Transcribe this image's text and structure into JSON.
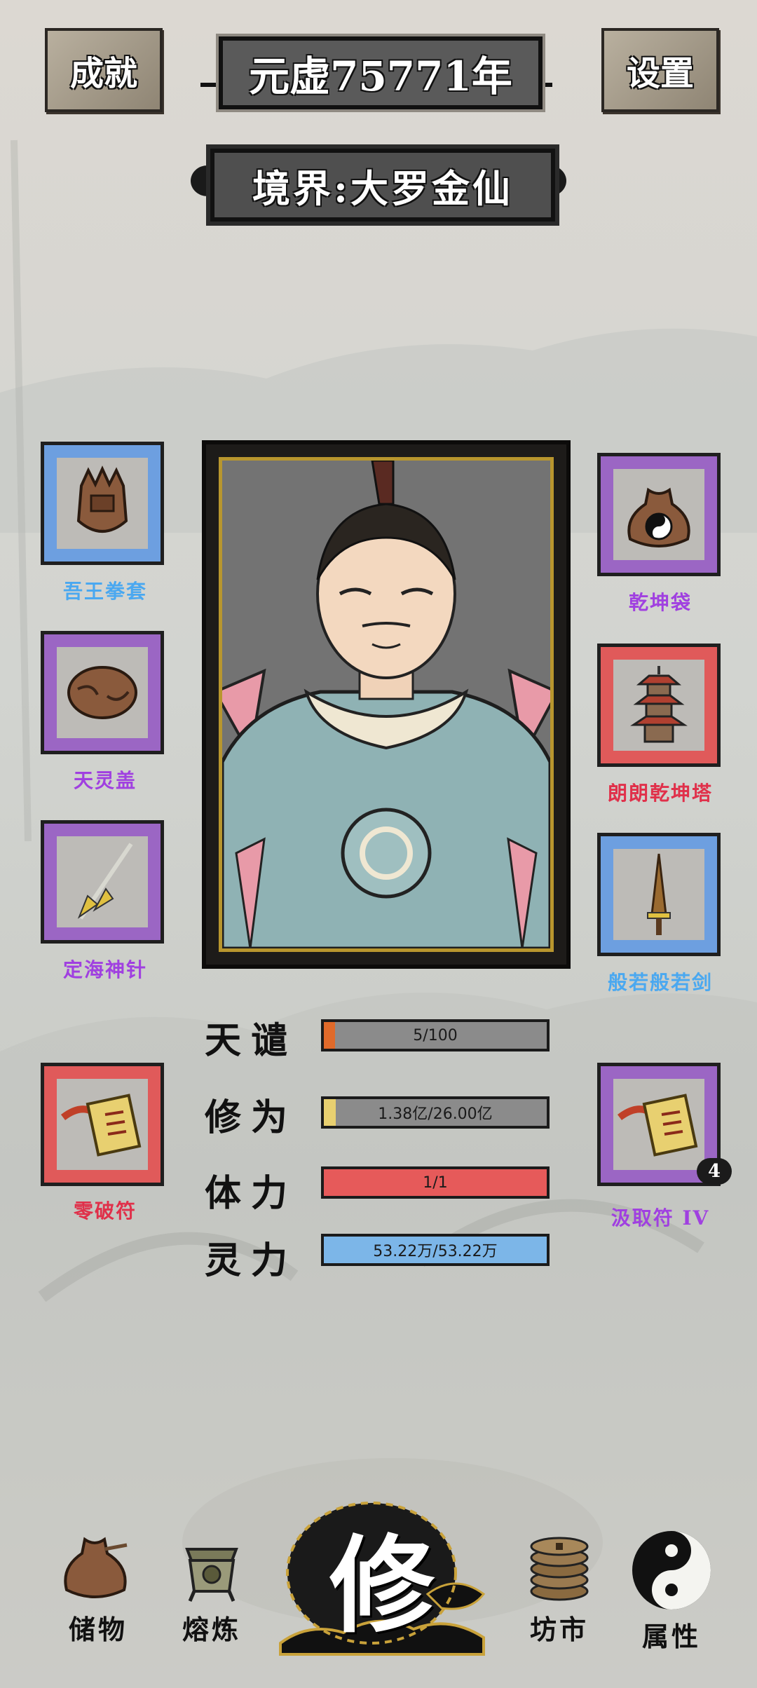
{
  "header": {
    "achievement_label": "成就",
    "settings_label": "设置",
    "year_label": "元虚75771年",
    "realm_label": "境界:大罗金仙"
  },
  "equipment": {
    "left": [
      {
        "name": "吾王拳套",
        "rarity_color": "#4aa8f0"
      },
      {
        "name": "天灵盖",
        "rarity_color": "#a040e0"
      },
      {
        "name": "定海神针",
        "rarity_color": "#a040e0"
      },
      {
        "name": "零破符",
        "rarity_color": "#e0304a"
      }
    ],
    "right": [
      {
        "name": "乾坤袋",
        "rarity_color": "#a040e0"
      },
      {
        "name": "朗朗乾坤塔",
        "rarity_color": "#e0304a"
      },
      {
        "name": "般若般若剑",
        "rarity_color": "#4aa8f0"
      },
      {
        "name": "汲取符 IV",
        "rarity_color": "#a040e0",
        "count": "4"
      }
    ]
  },
  "stats": [
    {
      "label": "天谴",
      "text": "5/100",
      "value": 0.05,
      "color": "#e06a2a"
    },
    {
      "label": "修为",
      "text": "1.38亿/26.00亿",
      "value": 0.053,
      "color": "#e8d070"
    },
    {
      "label": "体力",
      "text": "1/1",
      "value": 1.0,
      "color": "#e65a5a"
    },
    {
      "label": "灵力",
      "text": "53.22万/53.22万",
      "value": 1.0,
      "color": "#7cb6e8"
    }
  ],
  "nav": {
    "storage": "储物",
    "forge": "熔炼",
    "cultivate": "修",
    "market": "坊市",
    "attributes": "属性"
  }
}
